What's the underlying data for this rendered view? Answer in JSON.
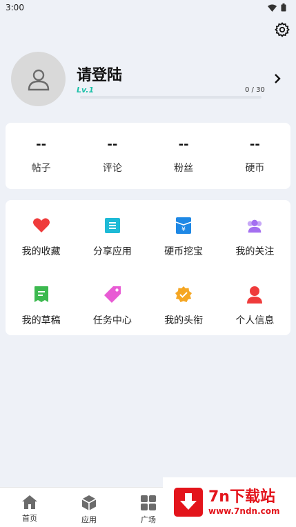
{
  "status_bar": {
    "time": "3:00"
  },
  "profile": {
    "title": "请登陆",
    "level": "Lv.1",
    "exp_text": "0 / 30",
    "exp_progress": 0
  },
  "stats": [
    {
      "value": "--",
      "label": "帖子"
    },
    {
      "value": "--",
      "label": "评论"
    },
    {
      "value": "--",
      "label": "粉丝"
    },
    {
      "value": "--",
      "label": "硬币"
    }
  ],
  "menu": [
    {
      "label": "我的收藏",
      "icon": "heart-icon",
      "color": "#ef3b3b"
    },
    {
      "label": "分享应用",
      "icon": "share-doc-icon",
      "color": "#1ebad6"
    },
    {
      "label": "硬币挖宝",
      "icon": "coin-icon",
      "color": "#1e88e5"
    },
    {
      "label": "我的关注",
      "icon": "follow-group-icon",
      "color": "#a46ff0"
    },
    {
      "label": "我的草稿",
      "icon": "draft-icon",
      "color": "#3cb94f"
    },
    {
      "label": "任务中心",
      "icon": "tag-icon",
      "color": "#e85bd4"
    },
    {
      "label": "我的头衔",
      "icon": "badge-icon",
      "color": "#f5a623"
    },
    {
      "label": "个人信息",
      "icon": "user-icon",
      "color": "#ef3b3b"
    }
  ],
  "bottom_nav": [
    {
      "label": "首页",
      "icon": "home-icon"
    },
    {
      "label": "应用",
      "icon": "apps-cube-icon"
    },
    {
      "label": "广场",
      "icon": "grid-icon"
    }
  ],
  "watermark": {
    "title": "7n下载站",
    "url": "www.7ndn.com"
  }
}
